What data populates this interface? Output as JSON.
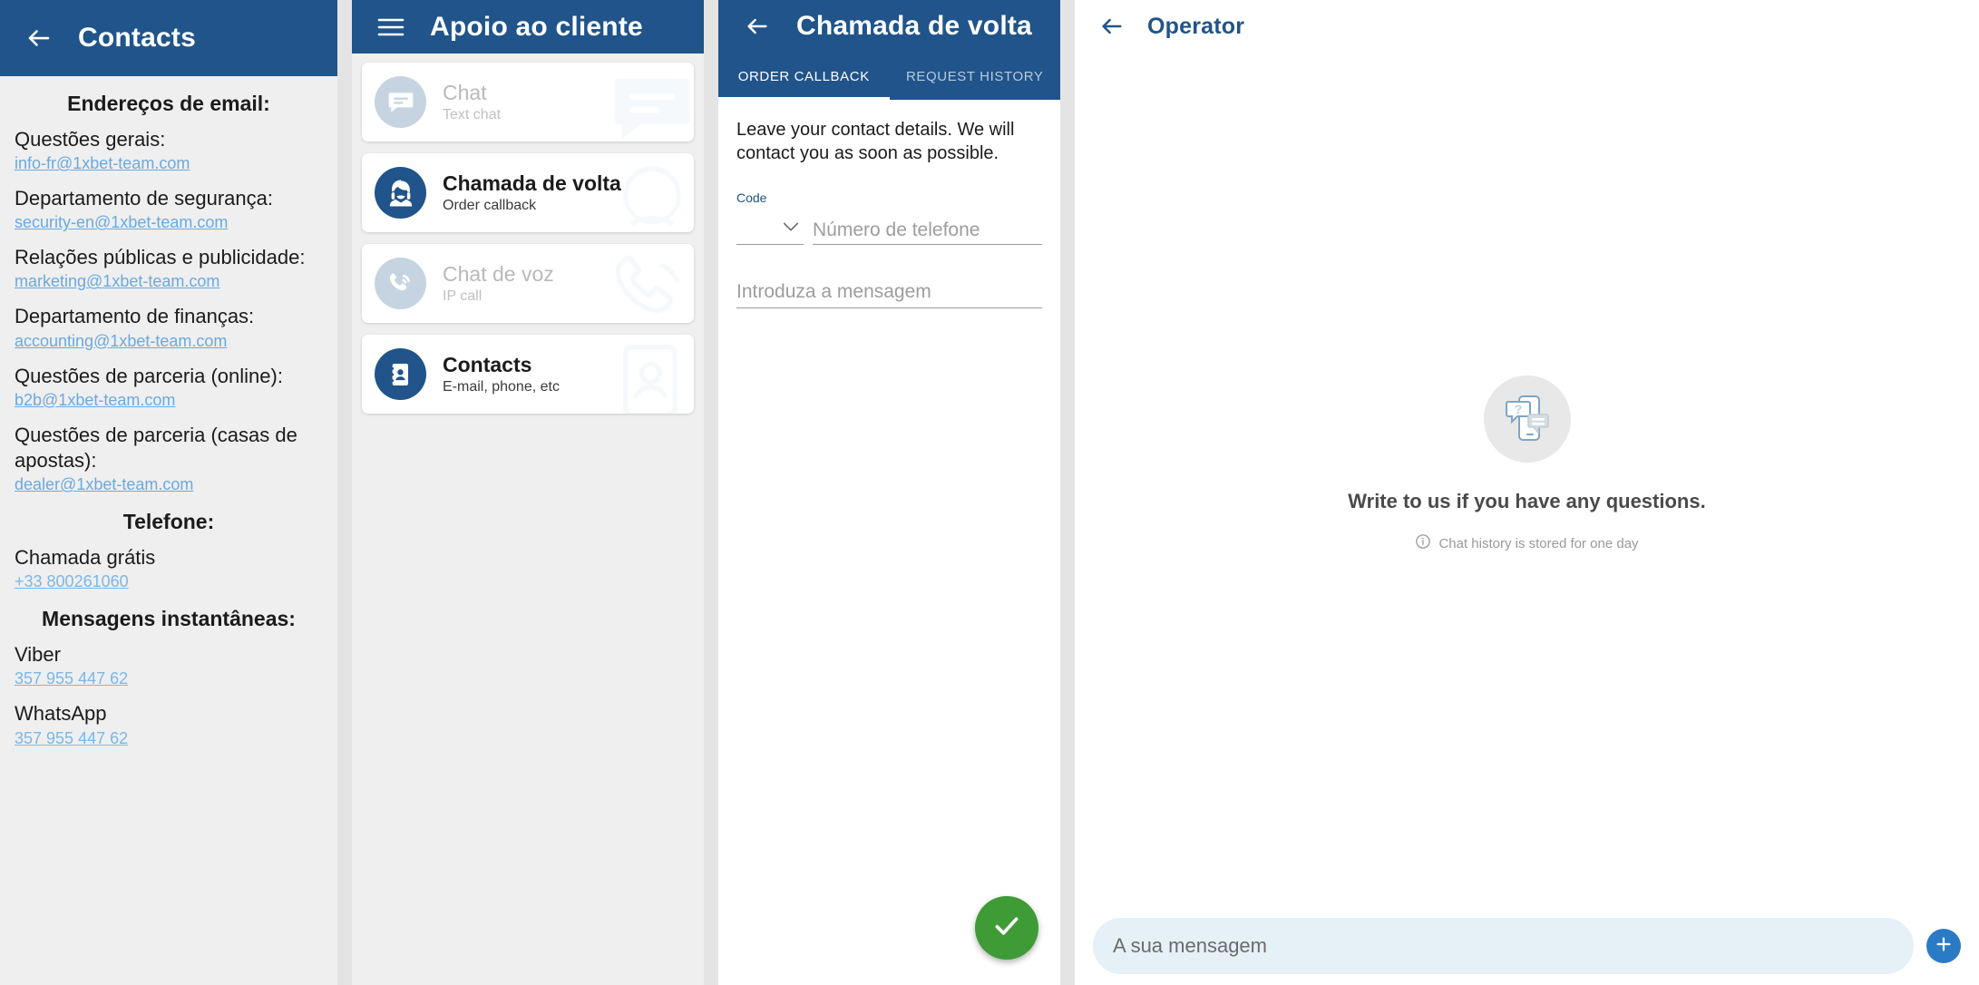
{
  "colors": {
    "brand_blue": "#20548a",
    "link_blue": "#6aa9e0",
    "fab_green": "#3f9b35",
    "composer_blue": "#2b7bc4",
    "panel_bg": "#efefef"
  },
  "panel_contacts": {
    "appbar": {
      "back_icon": "arrow-left-icon",
      "title": "Contacts"
    },
    "sections": [
      {
        "heading": "Endereços de email:"
      },
      {
        "heading": "Telefone:"
      },
      {
        "heading": "Mensagens instantâneas:"
      }
    ],
    "emails_heading": "Endereços de email:",
    "emails": [
      {
        "label": "Questões gerais:",
        "value": "info-fr@1xbet-team.com"
      },
      {
        "label": "Departamento de segurança:",
        "value": "security-en@1xbet-team.com"
      },
      {
        "label": "Relações públicas e publicidade:",
        "value": "marketing@1xbet-team.com"
      },
      {
        "label": "Departamento de finanças:",
        "value": "accounting@1xbet-team.com"
      },
      {
        "label": "Questões de parceria (online):",
        "value": "b2b@1xbet-team.com"
      },
      {
        "label": "Questões de parceria (casas de apostas):",
        "value": "dealer@1xbet-team.com"
      }
    ],
    "phone_heading": "Telefone:",
    "phones": [
      {
        "label": "Chamada grátis",
        "value": "+33 800261060"
      }
    ],
    "im_heading": "Mensagens instantâneas:",
    "messengers": [
      {
        "label": "Viber",
        "value": "357 955 447 62"
      },
      {
        "label": "WhatsApp",
        "value": "357 955 447 62"
      }
    ]
  },
  "panel_support": {
    "appbar": {
      "menu_icon": "hamburger-menu-icon",
      "title": "Apoio ao cliente"
    },
    "items": [
      {
        "title": "Chat",
        "subtitle": "Text chat",
        "icon": "chat-bubble-icon",
        "state": "disabled"
      },
      {
        "title": "Chamada de volta",
        "subtitle": "Order callback",
        "icon": "operator-headset-icon",
        "state": "active"
      },
      {
        "title": "Chat de voz",
        "subtitle": "IP call",
        "icon": "phone-call-icon",
        "state": "disabled"
      },
      {
        "title": "Contacts",
        "subtitle": "E-mail, phone, etc",
        "icon": "contact-card-icon",
        "state": "active"
      }
    ]
  },
  "panel_callback": {
    "appbar": {
      "back_icon": "arrow-left-icon",
      "title": "Chamada de volta"
    },
    "tabs": [
      {
        "label": "ORDER CALLBACK",
        "active": true
      },
      {
        "label": "REQUEST HISTORY",
        "active": false
      }
    ],
    "intro": "Leave your contact details. We will contact you as soon as possible.",
    "code_label": "Code",
    "code_value": "",
    "code_chevron_icon": "chevron-down-icon",
    "phone_placeholder": "Número de telefone",
    "phone_value": "",
    "message_placeholder": "Introduza a mensagem",
    "message_value": "",
    "submit_icon": "check-icon"
  },
  "panel_operator": {
    "appbar": {
      "back_icon": "arrow-left-icon",
      "title": "Operator"
    },
    "empty_illustration_icon": "chat-phone-illustration-icon",
    "empty_title": "Write to us if you have any questions.",
    "empty_info_icon": "info-icon",
    "empty_subtitle": "Chat history is stored for one day",
    "composer_placeholder": "A sua mensagem",
    "composer_value": "",
    "attach_icon": "plus-icon"
  }
}
